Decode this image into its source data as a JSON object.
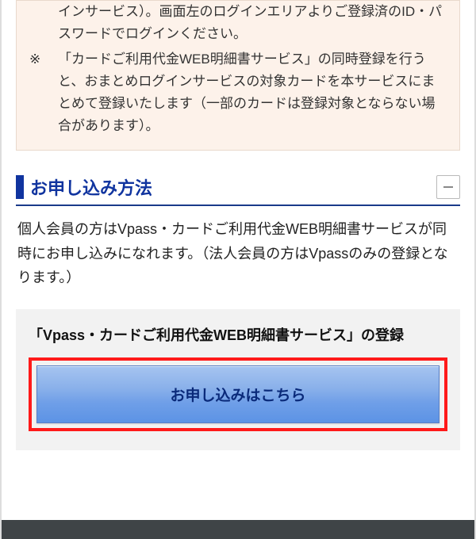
{
  "notice": {
    "items": [
      {
        "marker": "",
        "text": "インサービス）。画面左のログインエリアよりご登録済のID・パスワードでログインください。"
      },
      {
        "marker": "※",
        "text": "「カードご利用代金WEB明細書サービス」の同時登録を行うと、おまとめログインサービスの対象カードを本サービスにまとめて登録いたします（一部のカードは登録対象とならない場合があります）。"
      }
    ]
  },
  "section": {
    "title": "お申し込み方法",
    "body": "個人会員の方はVpass・カードご利用代金WEB明細書サービスが同時にお申し込みになれます。（法人会員の方はVpassのみの登録となります。）"
  },
  "registration": {
    "title": "「Vpass・カードご利用代金WEB明細書サービス」の登録",
    "apply_label": "お申し込みはこちら"
  }
}
